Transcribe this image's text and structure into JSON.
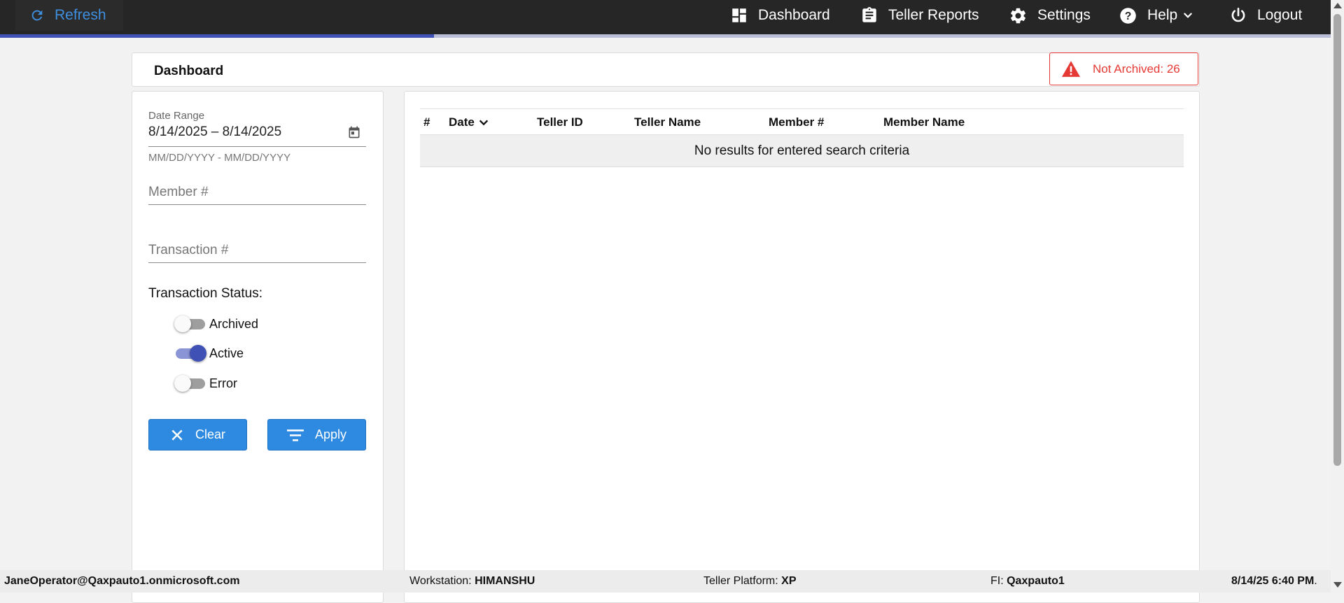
{
  "topbar": {
    "refresh_label": "Refresh",
    "nav": [
      {
        "label": "Dashboard",
        "icon": "dashboard-icon"
      },
      {
        "label": "Teller Reports",
        "icon": "clipboard-icon"
      },
      {
        "label": "Settings",
        "icon": "gear-icon"
      },
      {
        "label": "Help",
        "icon": "help-icon"
      },
      {
        "label": "Logout",
        "icon": "power-icon"
      }
    ],
    "progress_fraction": 0.326
  },
  "header": {
    "title": "Dashboard",
    "alert_text": "Not Archived: 26"
  },
  "filters": {
    "date_range_label": "Date Range",
    "date_range_value": "8/14/2025 – 8/14/2025",
    "date_hint": "MM/DD/YYYY - MM/DD/YYYY",
    "member_placeholder": "Member #",
    "transaction_placeholder": "Transaction #",
    "status_label": "Transaction Status:",
    "statuses": [
      {
        "label": "Archived",
        "on": false
      },
      {
        "label": "Active",
        "on": true
      },
      {
        "label": "Error",
        "on": false
      }
    ],
    "clear_label": "Clear",
    "apply_label": "Apply"
  },
  "table": {
    "columns": [
      "#",
      "Date",
      "Teller ID",
      "Teller Name",
      "Member #",
      "Member Name"
    ],
    "empty_message": "No results for entered search criteria"
  },
  "footer": {
    "user": "JaneOperator@Qaxpauto1.onmicrosoft.com",
    "workstation_label": "Workstation: ",
    "workstation": "HIMANSHU",
    "platform_label": "Teller Platform: ",
    "platform": "XP",
    "fi_label": "FI: ",
    "fi": "Qaxpauto1",
    "datetime": "8/14/25 6:40 PM",
    "datetime_suffix": "."
  },
  "colors": {
    "topbar": "#262626",
    "accent": "#3f51b5",
    "button": "#2e8ae0",
    "alert": "#e53935"
  }
}
